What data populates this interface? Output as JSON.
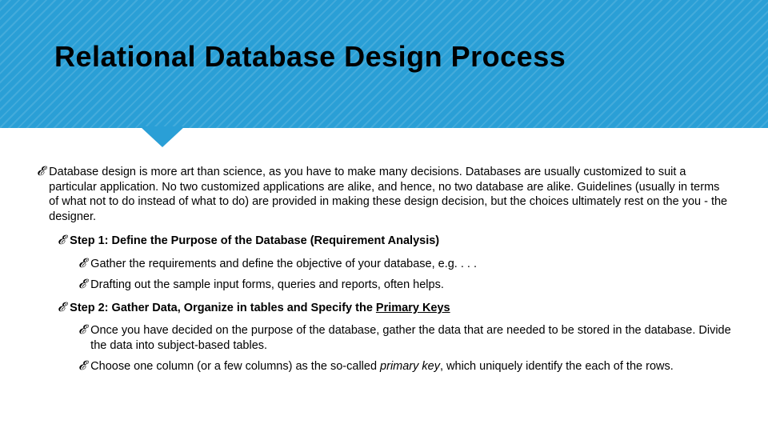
{
  "title": "Relational Database Design Process",
  "intro": "Database design is more art than science, as you have to make many decisions. Databases are usually customized to suit a particular application. No two customized applications are alike, and hence, no two database are alike. Guidelines (usually in terms of what not to do instead of what to do) are provided in making these design decision, but the choices ultimately rest on the you - the designer.",
  "step1_label": "Step 1: Define the Purpose of the Database (Requirement Analysis)",
  "step1_a": "Gather the requirements and define the objective of your database, e.g. . . .",
  "step1_b": "Drafting out the sample input forms, queries and reports, often helps.",
  "step2_prefix": "Step 2: Gather Data, Organize in tables and Specify the ",
  "step2_pk": "Primary Keys",
  "step2_a": "Once you have decided on the purpose of the database, gather the data that are needed to be stored in the database. Divide the data into subject-based tables.",
  "step2_b_pre": "Choose one column (or a few columns) as the so-called ",
  "step2_b_pk": "primary key",
  "step2_b_post": ", which uniquely identify the each of the rows."
}
